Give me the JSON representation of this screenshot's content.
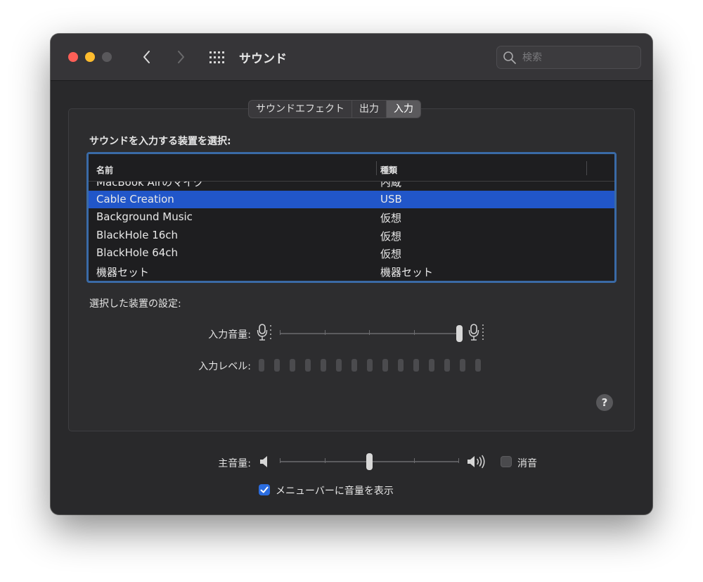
{
  "window": {
    "title": "サウンド"
  },
  "search": {
    "placeholder": "検索"
  },
  "tabs": [
    {
      "label": "サウンドエフェクト",
      "active": false
    },
    {
      "label": "出力",
      "active": false
    },
    {
      "label": "入力",
      "active": true
    }
  ],
  "input": {
    "select_label": "サウンドを入力する装置を選択:",
    "columns": {
      "name": "名前",
      "type": "種類"
    },
    "devices": [
      {
        "name": "MacBook Airのマイク",
        "type": "内蔵",
        "selected": false
      },
      {
        "name": "Cable Creation",
        "type": "USB",
        "selected": true
      },
      {
        "name": "Background Music",
        "type": "仮想",
        "selected": false
      },
      {
        "name": "BlackHole 16ch",
        "type": "仮想",
        "selected": false
      },
      {
        "name": "BlackHole 64ch",
        "type": "仮想",
        "selected": false
      },
      {
        "name": "機器セット",
        "type": "機器セット",
        "selected": false
      }
    ],
    "settings_label": "選択した装置の設定:",
    "volume_label": "入力音量:",
    "volume_level": 1.0,
    "level_label": "入力レベル:",
    "level_segments": 15,
    "level_active": 0
  },
  "help_label": "?",
  "output": {
    "volume_label": "主音量:",
    "volume_level": 0.5,
    "mute_label": "消音",
    "muted": false,
    "menubar_label": "メニューバーに音量を表示",
    "menubar_checked": true
  },
  "colors": {
    "accent": "#2156c9",
    "table_border": "#3a6aa6",
    "checkbox": "#2b6de0"
  }
}
